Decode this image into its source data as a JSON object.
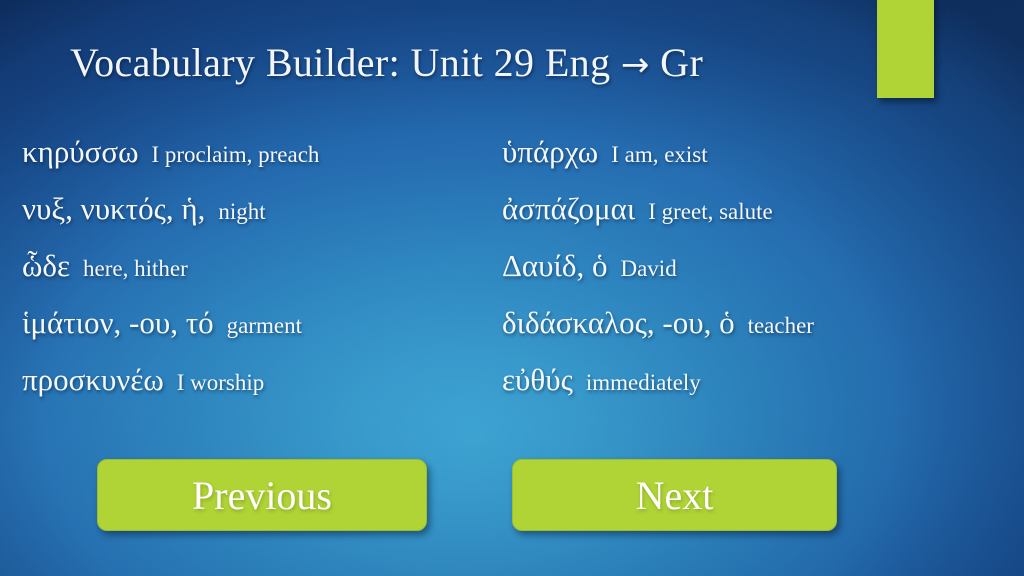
{
  "slide": {
    "title": "Vocabulary Builder:  Unit 29   Eng ",
    "title_arrow": "→",
    "title_tail": " Gr",
    "accent_color": "#b0d336",
    "background_color": "#10356d",
    "text_color": "#f4f8fc"
  },
  "vocabulary": {
    "left_column": [
      {
        "greek": "κηρύσσω",
        "english": "I proclaim, preach"
      },
      {
        "greek": "νυξ,  νυκτός, ἡ,",
        "english": "night"
      },
      {
        "greek": "ὧδε",
        "english": "here, hither"
      },
      {
        "greek": "ἱμάτιον, -ου, τό",
        "english": "garment"
      },
      {
        "greek": "προσκυνέω",
        "english": "I worship"
      }
    ],
    "right_column": [
      {
        "greek": "ὑπάρχω",
        "english": "I am, exist"
      },
      {
        "greek": "ἀσπάζομαι",
        "english": "I greet, salute"
      },
      {
        "greek": "Δαυίδ, ὁ",
        "english": "David"
      },
      {
        "greek": "διδάσκαλος,  -ου,  ὁ",
        "english": "teacher"
      },
      {
        "greek": "εὐθύς",
        "english": "immediately"
      }
    ]
  },
  "navigation": {
    "previous_label": "Previous",
    "next_label": "Next"
  }
}
